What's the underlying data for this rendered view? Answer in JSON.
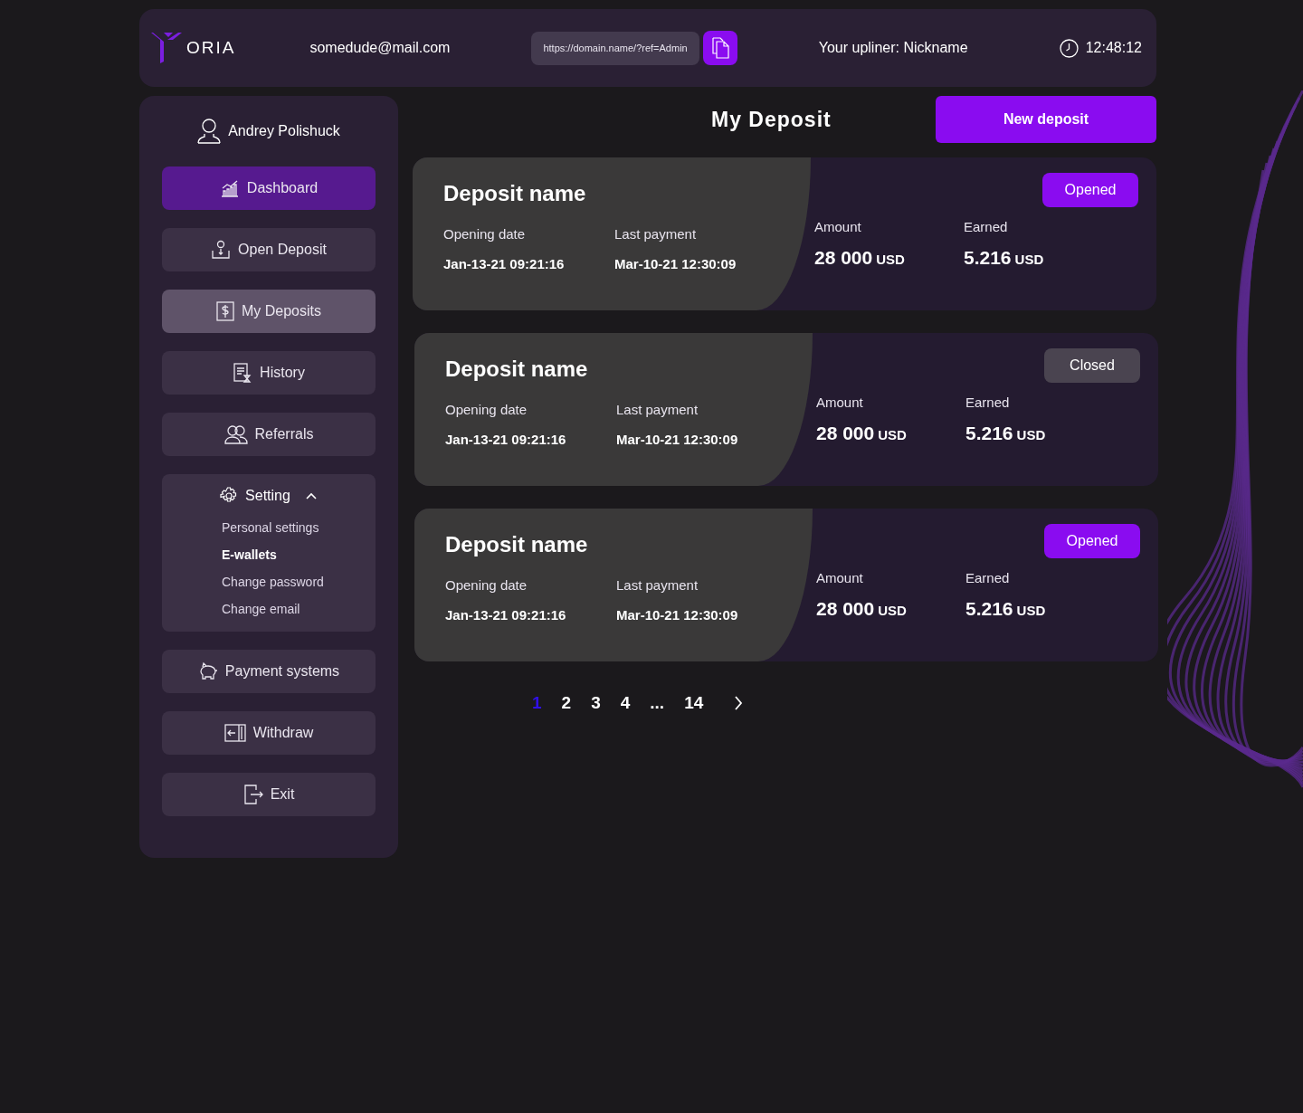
{
  "header": {
    "logo_text": "ORIA",
    "email": "somedude@mail.com",
    "ref_link": "https://domain.name/?ref=Admin",
    "upliner": "Your upliner: Nickname",
    "time": "12:48:12"
  },
  "sidebar": {
    "user": "Andrey Polishuck",
    "items": [
      {
        "label": "Dashboard",
        "kind": "active"
      },
      {
        "label": "Open Deposit",
        "kind": "normal"
      },
      {
        "label": "My Deposits",
        "kind": "hover"
      },
      {
        "label": "History",
        "kind": "normal"
      },
      {
        "label": "Referrals",
        "kind": "normal"
      }
    ],
    "settings": {
      "label": "Setting",
      "expanded": true,
      "children": [
        {
          "label": "Personal settings",
          "selected": false
        },
        {
          "label": "E-wallets",
          "selected": true
        },
        {
          "label": "Change password",
          "selected": false
        },
        {
          "label": "Change email",
          "selected": false
        }
      ]
    },
    "bottom_items": [
      {
        "label": "Payment systems",
        "kind": "normal"
      },
      {
        "label": "Withdraw",
        "kind": "normal"
      },
      {
        "label": "Exit",
        "kind": "normal"
      }
    ]
  },
  "main": {
    "title": "My Deposit",
    "new_button": "New deposit",
    "deposits": [
      {
        "name": "Deposit name",
        "status": "Opened",
        "kind": "opened",
        "opening_label": "Opening date",
        "opening": "Jan-13-21 09:21:16",
        "last_label": "Last payment",
        "last": "Mar-10-21 12:30:09",
        "amount_label": "Amount",
        "amount": "28 000",
        "amount_unit": "USD",
        "earned_label": "Earned",
        "earned": "5.216",
        "earned_unit": "USD"
      },
      {
        "name": "Deposit name",
        "status": "Closed",
        "kind": "closed",
        "opening_label": "Opening date",
        "opening": "Jan-13-21 09:21:16",
        "last_label": "Last payment",
        "last": "Mar-10-21 12:30:09",
        "amount_label": "Amount",
        "amount": "28 000",
        "amount_unit": "USD",
        "earned_label": "Earned",
        "earned": "5.216",
        "earned_unit": "USD"
      },
      {
        "name": "Deposit name",
        "status": "Opened",
        "kind": "opened",
        "opening_label": "Opening date",
        "opening": "Jan-13-21 09:21:16",
        "last_label": "Last payment",
        "last": "Mar-10-21 12:30:09",
        "amount_label": "Amount",
        "amount": "28 000",
        "amount_unit": "USD",
        "earned_label": "Earned",
        "earned": "5.216",
        "earned_unit": "USD"
      }
    ],
    "pagination": [
      {
        "label": "1",
        "selected": true
      },
      {
        "label": "2",
        "selected": false
      },
      {
        "label": "3",
        "selected": false
      },
      {
        "label": "4",
        "selected": false
      },
      {
        "label": "...",
        "selected": false
      },
      {
        "label": "14",
        "selected": false
      }
    ]
  }
}
